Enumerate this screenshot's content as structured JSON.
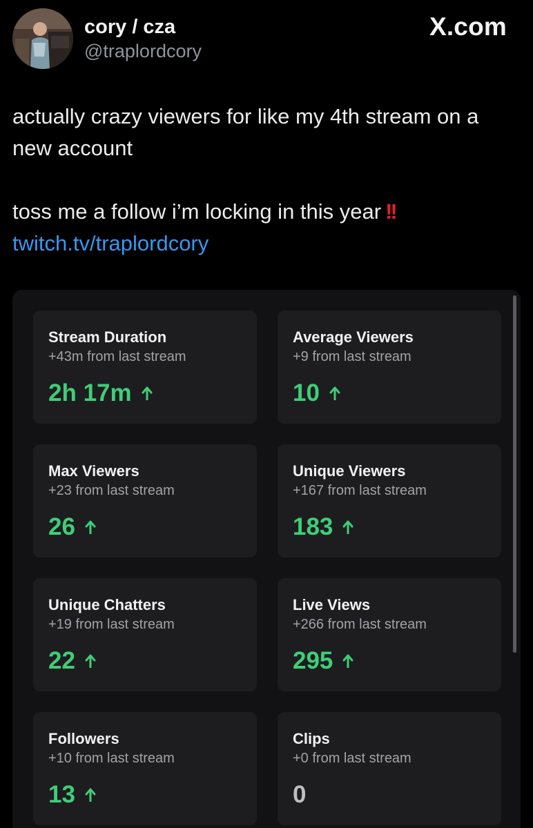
{
  "header": {
    "display_name": "cory / cza",
    "handle": "@traplordcory",
    "brand": "X.com"
  },
  "tweet": {
    "line1": "actually crazy viewers for like my 4th stream on a new account",
    "line2": "toss me a follow i’m locking in this year",
    "emphasis": "!!",
    "link": "twitch.tv/traplordcory"
  },
  "stats": [
    {
      "label": "Stream Duration",
      "delta": "+43m from last stream",
      "value": "2h 17m",
      "trend": "up"
    },
    {
      "label": "Average Viewers",
      "delta": "+9 from last stream",
      "value": "10",
      "trend": "up"
    },
    {
      "label": "Max Viewers",
      "delta": "+23 from last stream",
      "value": "26",
      "trend": "up"
    },
    {
      "label": "Unique Viewers",
      "delta": "+167 from last stream",
      "value": "183",
      "trend": "up"
    },
    {
      "label": "Unique Chatters",
      "delta": "+19 from last stream",
      "value": "22",
      "trend": "up"
    },
    {
      "label": "Live Views",
      "delta": "+266 from last stream",
      "value": "295",
      "trend": "up"
    },
    {
      "label": "Followers",
      "delta": "+10 from last stream",
      "value": "13",
      "trend": "up"
    },
    {
      "label": "Clips",
      "delta": "+0 from last stream",
      "value": "0",
      "trend": "none"
    }
  ],
  "colors": {
    "background": "#000000",
    "link": "#3a96ee",
    "positive": "#3fce78",
    "emphasis": "#e0242b",
    "card": "#1d1d20"
  },
  "icons": {
    "trend_up": "arrow-up-icon",
    "emphasis": "double-exclamation-icon"
  }
}
